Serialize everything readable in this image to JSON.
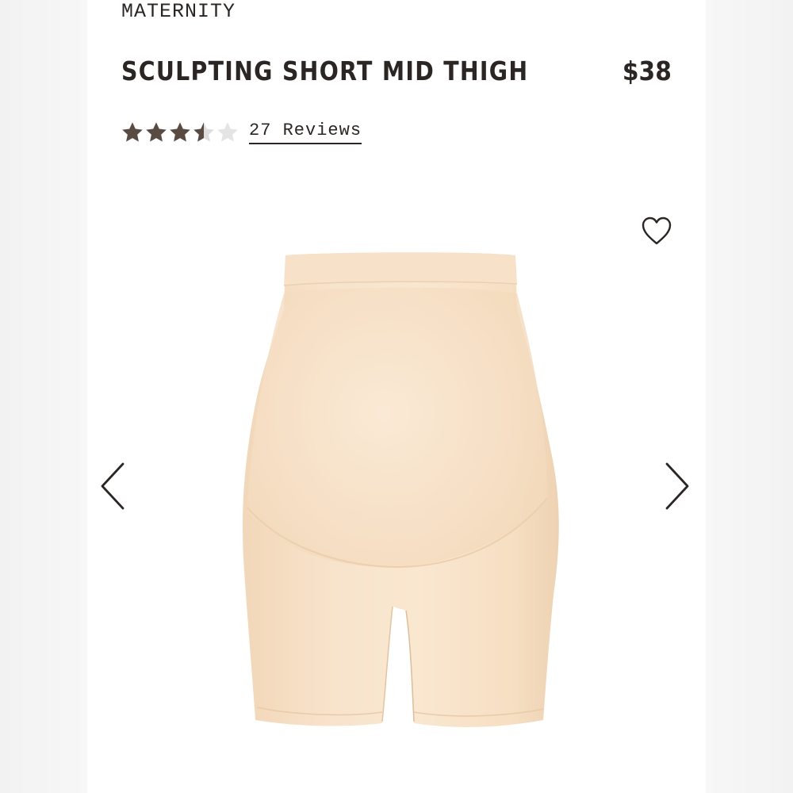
{
  "product": {
    "category": "MATERNITY",
    "title": "SCULPTING SHORT MID THIGH",
    "price": "$38",
    "rating": 3.5,
    "rating_max": 5,
    "reviews_label": "27 Reviews"
  },
  "icons": {
    "wishlist": "heart-outline-icon",
    "prev": "chevron-left-icon",
    "next": "chevron-right-icon",
    "star": "star-icon"
  },
  "colors": {
    "text": "#2b2623",
    "star_filled": "#5a4b42",
    "star_empty": "#dddddd",
    "product": "#f6dfc3"
  }
}
